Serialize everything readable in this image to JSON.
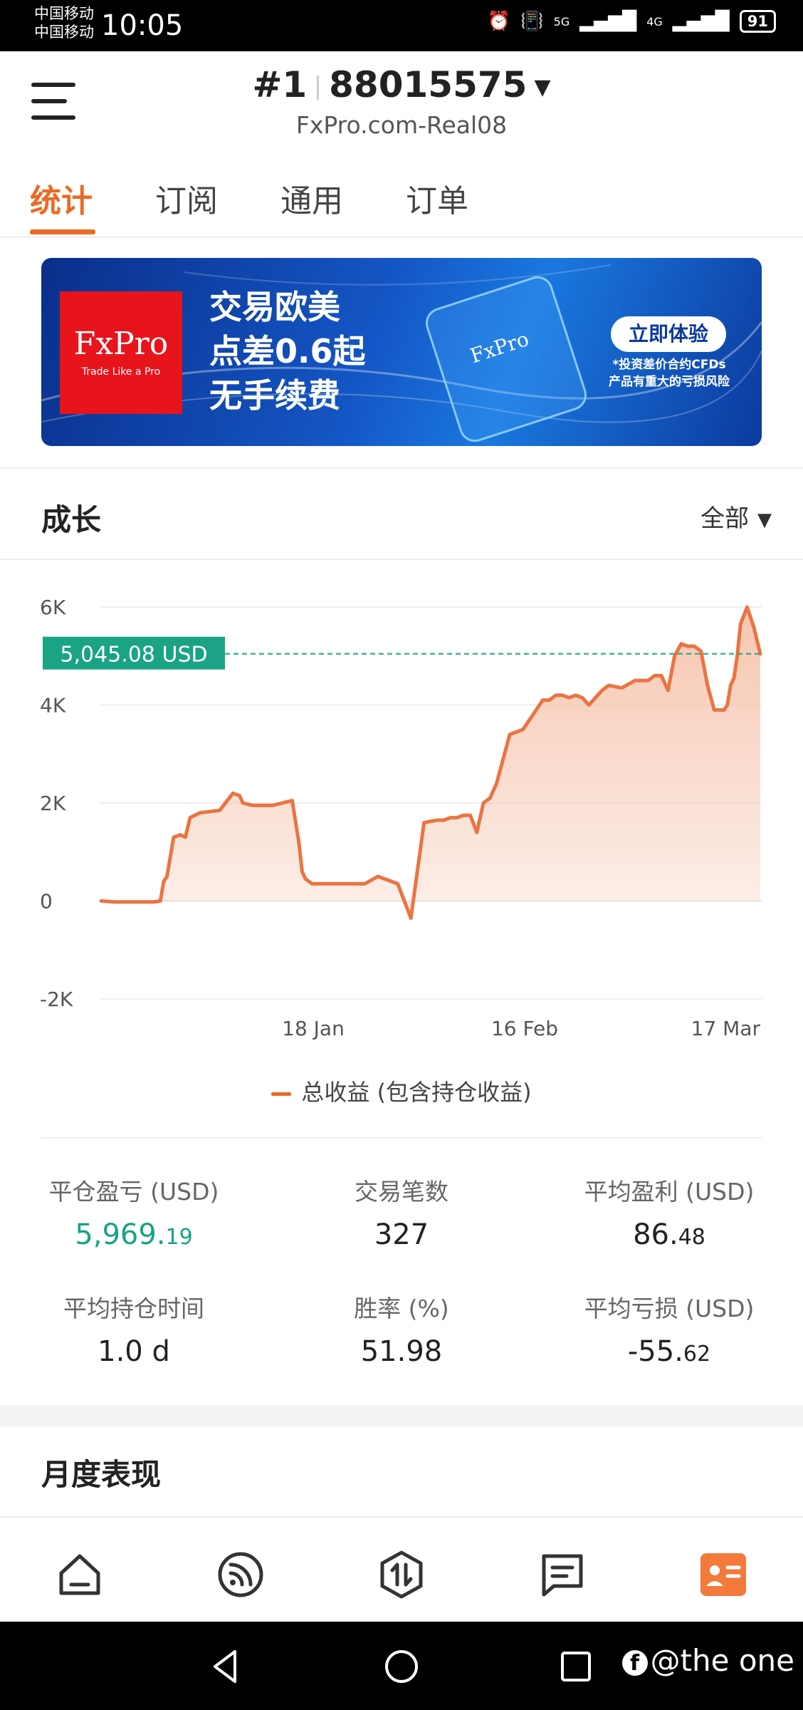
{
  "status_bar": {
    "carrier_1": "中国移动",
    "carrier_2": "中国移动",
    "time": "10:05",
    "signal_1": "5G",
    "signal_2": "4G",
    "battery": "91"
  },
  "header": {
    "account_index": "#1",
    "account_number": "88015575",
    "server": "FxPro.com-Real08"
  },
  "tabs": [
    {
      "label": "统计",
      "active": true
    },
    {
      "label": "订阅",
      "active": false
    },
    {
      "label": "通用",
      "active": false
    },
    {
      "label": "订单",
      "active": false
    }
  ],
  "banner": {
    "logo_text": "FxPro",
    "logo_tagline": "Trade Like a Pro",
    "headline_1": "交易欧美",
    "headline_2": "点差0.6起",
    "headline_3": "无手续费",
    "cta": "立即体验",
    "disclaimer_1": "*投资差价合约CFDs",
    "disclaimer_2": "产品有重大的亏损风险"
  },
  "growth": {
    "title": "成长",
    "period": "全部"
  },
  "chart_data": {
    "type": "area",
    "title": "",
    "xlabel": "",
    "ylabel": "",
    "ylim": [
      -2000,
      6000
    ],
    "yticks": [
      -2000,
      0,
      2000,
      4000,
      6000
    ],
    "ytick_labels": [
      "-2K",
      "0",
      "2K",
      "4K",
      "6K"
    ],
    "xtick_labels": [
      "18 Jan",
      "16 Feb",
      "17 Mar"
    ],
    "grid": true,
    "current_value": 5045.08,
    "current_label": "5,045.08 USD",
    "legend": "总收益 (包含持仓收益)",
    "series": [
      {
        "name": "总收益 (包含持仓收益)",
        "x": [
          0,
          2,
          4,
          6,
          8,
          9,
          9.5,
          10,
          11,
          12,
          12.8,
          13.5,
          15,
          18,
          20,
          21,
          21.5,
          23,
          26,
          29,
          30,
          30.5,
          31,
          32,
          33,
          35,
          40,
          42,
          45,
          47,
          49,
          51,
          52,
          53,
          54,
          55,
          56,
          57,
          58,
          59,
          60,
          62,
          64,
          65,
          66,
          67,
          68,
          69,
          70,
          71,
          72,
          73,
          74,
          75,
          76,
          77,
          79,
          81,
          83,
          84,
          85,
          86,
          87,
          88,
          89,
          90,
          91,
          92,
          93,
          93.5,
          94,
          94.5,
          95,
          95.5,
          96,
          96.5,
          97,
          98,
          99,
          100
        ],
        "y": [
          0,
          -20,
          -20,
          -20,
          -20,
          0,
          400,
          500,
          1300,
          1350,
          1300,
          1700,
          1800,
          1850,
          2200,
          2150,
          2000,
          1950,
          1950,
          2050,
          1200,
          600,
          450,
          350,
          350,
          350,
          350,
          500,
          350,
          -350,
          1600,
          1650,
          1650,
          1700,
          1700,
          1750,
          1750,
          1400,
          2000,
          2100,
          2400,
          3400,
          3500,
          3700,
          3900,
          4100,
          4100,
          4200,
          4200,
          4150,
          4200,
          4150,
          4000,
          4150,
          4300,
          4400,
          4350,
          4500,
          4500,
          4600,
          4600,
          4300,
          5000,
          5250,
          5200,
          5200,
          5100,
          4400,
          3900,
          3900,
          3900,
          3900,
          4000,
          4400,
          4550,
          5000,
          5650,
          6000,
          5600,
          5045
        ]
      }
    ]
  },
  "stats": [
    {
      "label": "平仓盈亏 (USD)",
      "int": "5,969.",
      "dec": "19",
      "color": "green"
    },
    {
      "label": "交易笔数",
      "int": "327",
      "dec": "",
      "color": "normal"
    },
    {
      "label": "平均盈利 (USD)",
      "int": "86.",
      "dec": "48",
      "color": "normal"
    },
    {
      "label": "平均持仓时间",
      "int": "1.0 d",
      "dec": "",
      "color": "normal"
    },
    {
      "label": "胜率 (%)",
      "int": "51.98",
      "dec": "",
      "color": "normal"
    },
    {
      "label": "平均亏损 (USD)",
      "int": "-55.",
      "dec": "62",
      "color": "normal"
    }
  ],
  "monthly": {
    "title": "月度表现"
  },
  "bottom_nav": [
    {
      "icon": "home-icon"
    },
    {
      "icon": "broadcast-icon"
    },
    {
      "icon": "trade-icon"
    },
    {
      "icon": "message-icon"
    },
    {
      "icon": "profile-card-icon",
      "active": true
    }
  ],
  "watermark": {
    "fb_glyph": "f",
    "text": "@the one"
  },
  "colors": {
    "accent": "#ea6b26",
    "green": "#1aa384",
    "chart_line": "#ea7442",
    "chart_fill": "#f6c3ac"
  }
}
